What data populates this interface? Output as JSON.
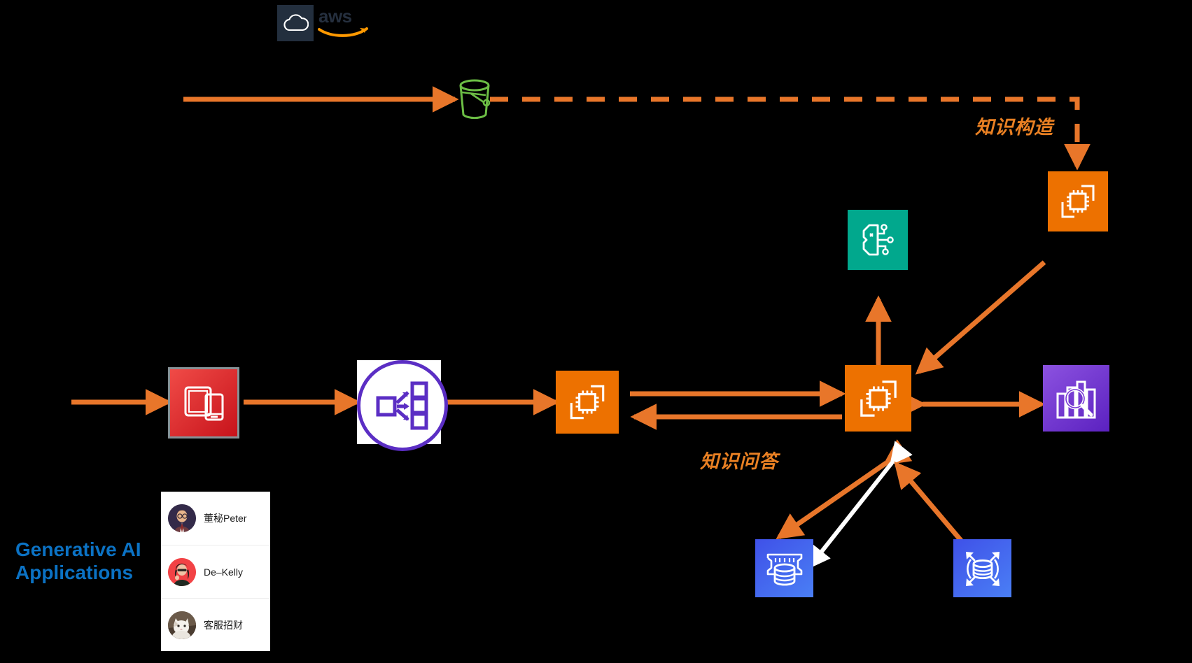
{
  "diagram": {
    "title": "AWS Generative AI Knowledge Base Architecture",
    "background": "#000000"
  },
  "brand": {
    "logo_text": "aws",
    "logo_icon": "cloud-icon",
    "logo_box_color": "#232f3e",
    "smile_color": "#ff9900"
  },
  "colors": {
    "orange": "#e98023",
    "arrow_orange": "#e8762a",
    "lambda": "#ed7100",
    "ml_teal": "#01a88d",
    "search_purple": "#7a3ad6",
    "db_blue": "#4168e8",
    "client_red": "#d81f26",
    "router_purple": "#5b2ec4",
    "bucket_green": "#6cbe45",
    "label_blue": "#0b72c4",
    "white": "#ffffff"
  },
  "labels": {
    "knowledge_build": "知识构造",
    "knowledge_qa": "知识问答",
    "gen_ai_line1": "Generative AI",
    "gen_ai_line2": "Applications"
  },
  "nodes": [
    {
      "id": "s3-bucket",
      "name": "s3-bucket-icon",
      "icon": "bucket-icon",
      "label": ""
    },
    {
      "id": "lambda-ingest",
      "name": "lambda-ingest-icon",
      "icon": "lambda-icon",
      "label": ""
    },
    {
      "id": "bedrock-model",
      "name": "bedrock-model-icon",
      "icon": "brain-ml-icon",
      "label": ""
    },
    {
      "id": "client-devices",
      "name": "client-devices-icon",
      "icon": "devices-icon",
      "label": ""
    },
    {
      "id": "api-router",
      "name": "api-gateway-router-icon",
      "icon": "router-icon",
      "label": ""
    },
    {
      "id": "lambda-front",
      "name": "lambda-frontend-icon",
      "icon": "lambda-icon",
      "label": ""
    },
    {
      "id": "lambda-core",
      "name": "lambda-core-icon",
      "icon": "lambda-icon",
      "label": ""
    },
    {
      "id": "opensearch",
      "name": "opensearch-icon",
      "icon": "search-bars-icon",
      "label": ""
    },
    {
      "id": "database-rds",
      "name": "database-rds-icon",
      "icon": "database-rack-icon",
      "label": ""
    },
    {
      "id": "database-scale",
      "name": "database-scalable-icon",
      "icon": "database-scale-icon",
      "label": ""
    }
  ],
  "applications": {
    "panel_name": "generative-ai-applications-panel",
    "items": [
      {
        "name": "董秘Peter",
        "avatar": "avatar-peter"
      },
      {
        "name": "De–Kelly",
        "avatar": "avatar-kelly"
      },
      {
        "name": "客服招财",
        "avatar": "avatar-cat"
      }
    ]
  }
}
